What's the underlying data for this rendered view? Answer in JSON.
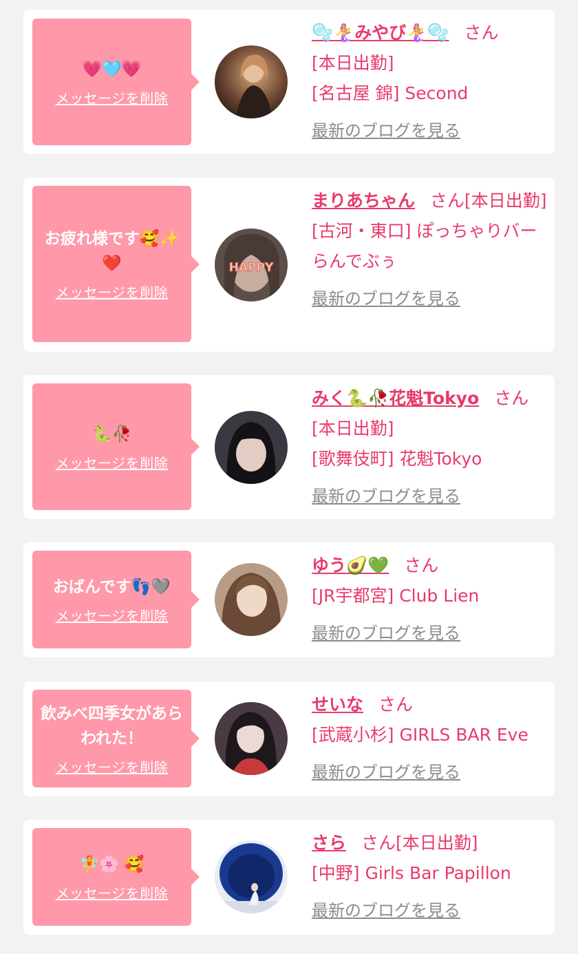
{
  "cards": [
    {
      "message": "💗🩵💗",
      "delete_label": "メッセージを削除",
      "name": "🫧🧜‍♀️みやび🧜‍♀️🫧",
      "honorific": "さん",
      "status": "[本日出勤]",
      "location": "[名古屋 錦] Second",
      "blog_label": "最新のブログを見る",
      "avatar_colors": [
        "#3a2a22",
        "#c89a70"
      ]
    },
    {
      "message": "お疲れ様です🥰✨❤️",
      "delete_label": "メッセージを削除",
      "name": "まりあちゃん",
      "honorific": "さん",
      "status": "[本日出勤]",
      "location": "[古河・東口] ぽっちゃりバー らんでぶぅ",
      "blog_label": "最新のブログを見る",
      "avatar_colors": [
        "#5a4a48",
        "#b8a098"
      ]
    },
    {
      "message": "🐍🥀",
      "delete_label": "メッセージを削除",
      "name": "みく🐍🥀花魁Tokyo",
      "honorific": "さん",
      "status": "[本日出勤]",
      "location": "[歌舞伎町] 花魁Tokyo",
      "blog_label": "最新のブログを見る",
      "avatar_colors": [
        "#1c1a1e",
        "#d8c0b8"
      ]
    },
    {
      "message": "おばんです👣🩶",
      "delete_label": "メッセージを削除",
      "name": "ゆう🥑💚",
      "honorific": "さん",
      "location": "[JR宇都宮] Club Lien",
      "blog_label": "最新のブログを見る",
      "avatar_colors": [
        "#6a5040",
        "#e0c4b0"
      ]
    },
    {
      "message": "飲みべ四季女があらわれた！",
      "delete_label": "メッセージを削除",
      "name": "せいな",
      "honorific": "さん",
      "location": "[武蔵小杉] GIRLS BAR Eve",
      "blog_label": "最新のブログを見る",
      "avatar_colors": [
        "#2a2028",
        "#c84040"
      ]
    },
    {
      "message": "🧚🌸 🥰",
      "delete_label": "メッセージを削除",
      "name": "さら",
      "honorific": "さん",
      "status": "[本日出勤]",
      "location": "[中野] Girls Bar Papillon",
      "blog_label": "最新のブログを見る",
      "avatar_colors": [
        "#1a3a8a",
        "#e8e8f0"
      ]
    }
  ]
}
